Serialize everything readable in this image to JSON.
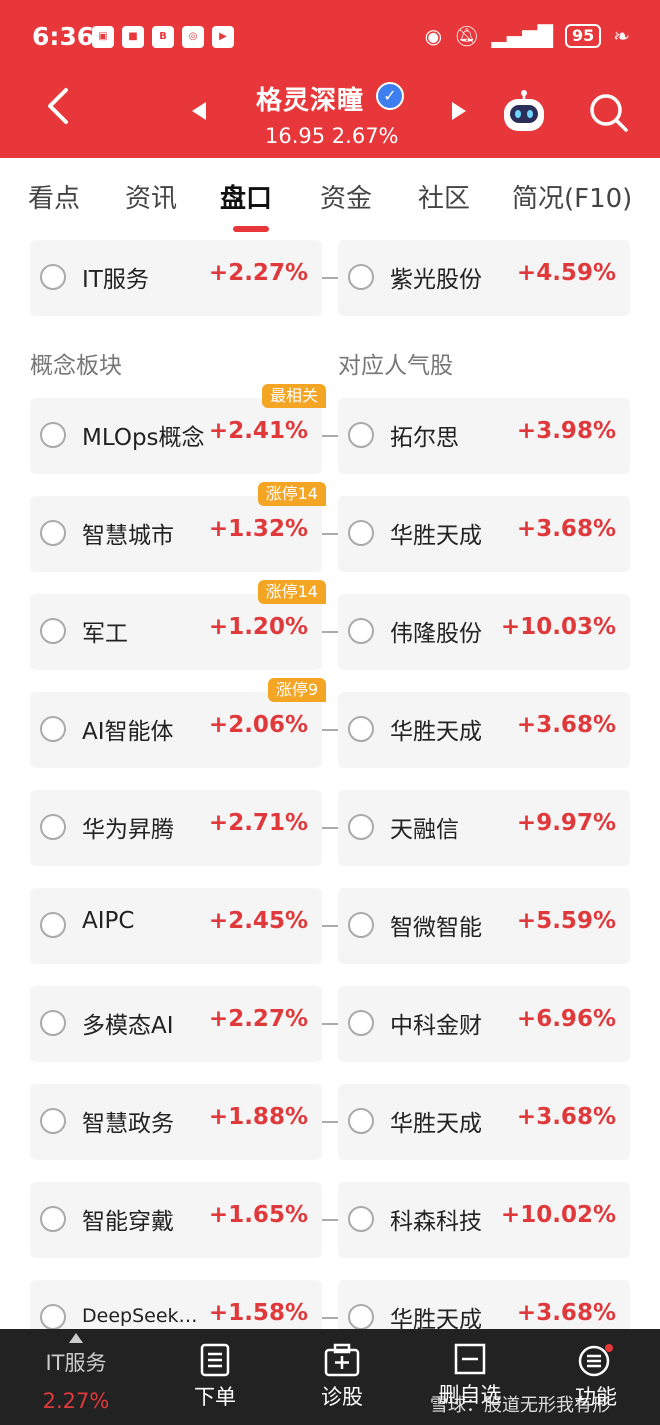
{
  "status_bar": {
    "time": "6:36",
    "battery": "95"
  },
  "header": {
    "stock_name": "格灵深瞳",
    "verified_mark": "✓",
    "price_line": "16.95 2.67%"
  },
  "tabs": [
    "看点",
    "资讯",
    "盘口",
    "资金",
    "社区",
    "简况(F10)"
  ],
  "active_tab": "盘口",
  "industry_row": {
    "left": {
      "name": "IT服务",
      "change": "+2.27%"
    },
    "right": {
      "name": "紫光股份",
      "change": "+4.59%"
    }
  },
  "sections": {
    "concept_title": "概念板块",
    "popular_title": "对应人气股"
  },
  "concept_rows": [
    {
      "concept": "MLOps概念",
      "concept_change": "+2.41%",
      "badge": "最相关",
      "stock": "拓尔思",
      "stock_change": "+3.98%"
    },
    {
      "concept": "智慧城市",
      "concept_change": "+1.32%",
      "badge": "涨停14",
      "stock": "华胜天成",
      "stock_change": "+3.68%"
    },
    {
      "concept": "军工",
      "concept_change": "+1.20%",
      "badge": "涨停14",
      "stock": "伟隆股份",
      "stock_change": "+10.03%"
    },
    {
      "concept": "AI智能体",
      "concept_change": "+2.06%",
      "badge": "涨停9",
      "stock": "华胜天成",
      "stock_change": "+3.68%"
    },
    {
      "concept": "华为昇腾",
      "concept_change": "+2.71%",
      "badge": "",
      "stock": "天融信",
      "stock_change": "+9.97%"
    },
    {
      "concept": "AIPC",
      "concept_change": "+2.45%",
      "badge": "",
      "stock": "智微智能",
      "stock_change": "+5.59%"
    },
    {
      "concept": "多模态AI",
      "concept_change": "+2.27%",
      "badge": "",
      "stock": "中科金财",
      "stock_change": "+6.96%"
    },
    {
      "concept": "智慧政务",
      "concept_change": "+1.88%",
      "badge": "",
      "stock": "华胜天成",
      "stock_change": "+3.68%"
    },
    {
      "concept": "智能穿戴",
      "concept_change": "+1.65%",
      "badge": "",
      "stock": "科森科技",
      "stock_change": "+10.02%"
    },
    {
      "concept": "DeepSeek…",
      "concept_change": "+1.58%",
      "badge": "",
      "stock": "华胜天成",
      "stock_change": "+3.68%"
    }
  ],
  "bottom_bar": {
    "index_name": "IT服务",
    "index_change": "2.27%",
    "items": [
      "下单",
      "诊股",
      "删自选",
      "功能"
    ]
  },
  "watermark": "雪球：股道无形我有形",
  "colors": {
    "brand_red": "#e8373a",
    "up_red": "#e0393c",
    "badge_orange": "#f5a524",
    "bottom_bar": "#222222"
  }
}
